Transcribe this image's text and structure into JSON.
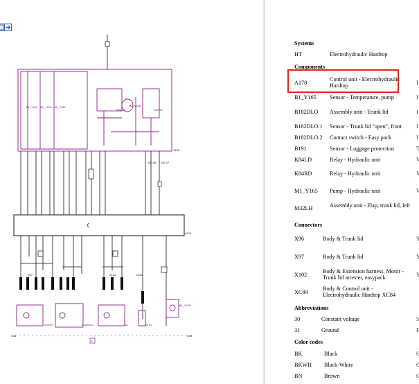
{
  "header": {
    "left_page_text": "",
    "right_page_text": ""
  },
  "toolbar": {
    "buttons": [
      {
        "name": "fit-page-icon"
      },
      {
        "name": "next-page-icon"
      }
    ]
  },
  "diagram": {
    "figure_id": "P146931",
    "ruler_start": "S48",
    "ruler_end": "S49",
    "page_marker": "F",
    "labels": {
      "b1": "B1_Y165",
      "b182_1": "B1_Y165",
      "b182_2": "B2_Y165",
      "k84ld": "K84LD",
      "m1": "M1_Y165",
      "k84rd": "K84RD",
      "y165": "Y165",
      "a178": "A178",
      "x102": "X102",
      "x97": "X97",
      "xc84": "XC84",
      "m32lh": "M32LH",
      "b182dlo": "B182DLO",
      "b191": "B191",
      "m1b": "M1_Y165",
      "b1b": "B1",
      "c1": "X0C36",
      "c2": "X0C37"
    }
  },
  "legend": {
    "sections": {
      "systems": "Systems",
      "components": "Components",
      "connectors": "Connectors",
      "abbreviations": "Abbreviations",
      "color_codes": "Color codes"
    },
    "systems": [
      {
        "code": "HT",
        "desc": "Electrohydraulic Hardtop"
      }
    ],
    "components": [
      {
        "code": "A178",
        "desc": "Control unit - Electrohydraulic Hardtop",
        "edge": "I"
      },
      {
        "code": "B1_Y165",
        "desc": "Sensor - Temperature, pump",
        "edge": "I"
      },
      {
        "code": "B182DLO",
        "desc": "Assembly unit - Trunk lid",
        "edge": "I"
      },
      {
        "code": "B182DLO.1",
        "desc": "Sensor - Trunk lid \"open\", front",
        "edge": "I"
      },
      {
        "code": "B182DLO.2",
        "desc": "Contact switch - Easy pack",
        "edge": "I"
      },
      {
        "code": "B191",
        "desc": "Sensor - Luggage protection",
        "edge": "T"
      },
      {
        "code": "K84LD",
        "desc": "Relay - Hydraulic unit",
        "edge": "V"
      },
      {
        "code": "K84RD",
        "desc": "Relay - Hydraulic unit",
        "edge": "V"
      },
      {
        "code": "M1_Y165",
        "desc": "Pump - Hydraulic unit",
        "edge": "V"
      },
      {
        "code": "M32LH",
        "desc": "Assembly unit - Flap, trunk lid, left",
        "edge": ""
      }
    ],
    "connectors": [
      {
        "code": "X96",
        "desc": "Body & Trunk lid",
        "edge": "Y"
      },
      {
        "code": "X97",
        "desc": "Body & Trunk lid",
        "edge": "Y"
      },
      {
        "code": "X102",
        "desc": "Body & Extension harness, Motor - Trunk lid arrester, easypack",
        "edge": "Y"
      },
      {
        "code": "XC84",
        "desc": "Body & Control unit - Electrohydraulic Hardtop XC84",
        "edge": ""
      }
    ],
    "abbreviations": [
      {
        "code": "30",
        "desc": "Constant voltage",
        "edge": "5"
      },
      {
        "code": "31",
        "desc": "Ground",
        "edge": "F"
      }
    ],
    "color_codes": [
      {
        "code": "BK",
        "desc": "Black",
        "edge": "G"
      },
      {
        "code": "BKWH",
        "desc": "Black-White",
        "edge": "G"
      },
      {
        "code": "BN",
        "desc": "Brown",
        "edge": "G"
      }
    ]
  },
  "colors": {
    "highlight": "#e0261a",
    "wire_purple": "#8b1a8b",
    "toolbar_accent": "#3a62b0"
  }
}
